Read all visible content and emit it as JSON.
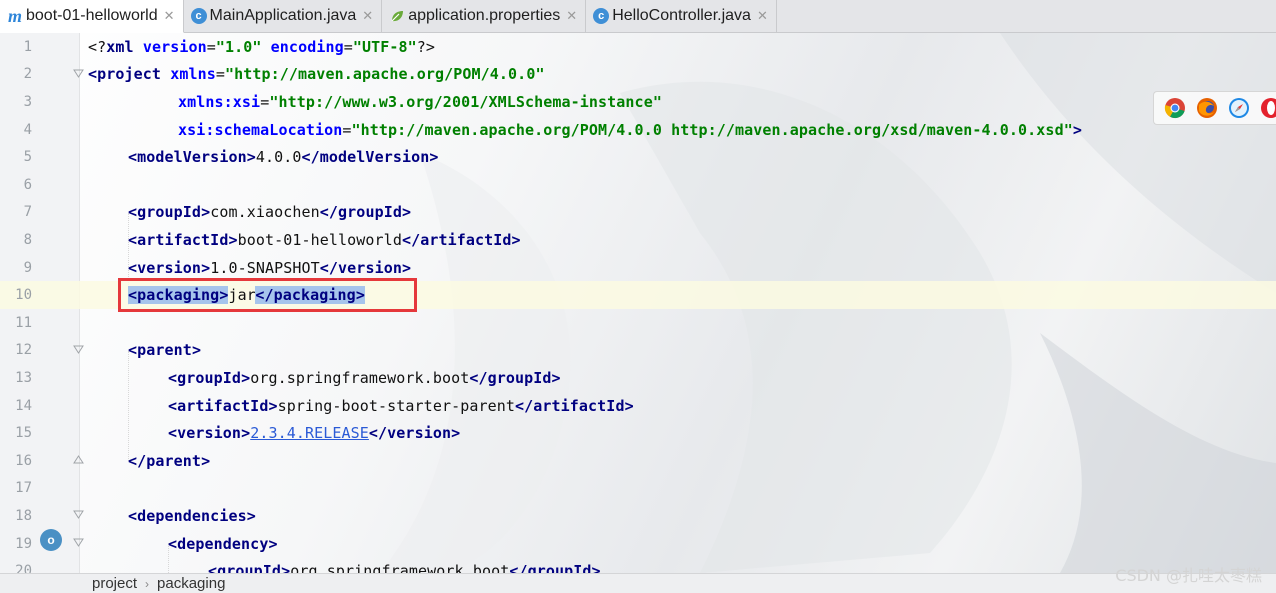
{
  "tabs": [
    {
      "label": "boot-01-helloworld",
      "icon": "maven-m-icon",
      "active": true
    },
    {
      "label": "MainApplication.java",
      "icon": "java-class-icon",
      "active": false
    },
    {
      "label": "application.properties",
      "icon": "spring-leaf-icon",
      "active": false
    },
    {
      "label": "HelloController.java",
      "icon": "java-class-icon",
      "active": false
    }
  ],
  "tab_close_glyph": "✕",
  "line_numbers": [
    "1",
    "2",
    "3",
    "4",
    "5",
    "6",
    "7",
    "8",
    "9",
    "10",
    "11",
    "12",
    "13",
    "14",
    "15",
    "16",
    "17",
    "18",
    "19",
    "20"
  ],
  "code": {
    "l1_decl_open": "<?",
    "l1_xml": "xml",
    "l1_version_attr": "version",
    "l1_version_val": "\"1.0\"",
    "l1_encoding_attr": "encoding",
    "l1_encoding_val": "\"UTF-8\"",
    "l1_decl_close": "?>",
    "l2_open": "<",
    "l2_project": "project",
    "l2_xmlns_attr": "xmlns",
    "l2_xmlns_val": "\"http://maven.apache.org/POM/4.0.0\"",
    "l3_xsi_attr": "xmlns:xsi",
    "l3_xsi_val": "\"http://www.w3.org/2001/XMLSchema-instance\"",
    "l4_schema_attr": "xsi:schemaLocation",
    "l4_schema_val": "\"http://maven.apache.org/POM/4.0.0 http://maven.apache.org/xsd/maven-4.0.0.xsd\"",
    "l4_close": ">",
    "modelVersion_tag": "modelVersion",
    "modelVersion_val": "4.0.0",
    "groupId_tag": "groupId",
    "groupId_val": "com.xiaochen",
    "artifactId_tag": "artifactId",
    "artifactId_val": "boot-01-helloworld",
    "version_tag": "version",
    "version_val": "1.0-SNAPSHOT",
    "packaging_tag": "packaging",
    "packaging_val_a": "jar",
    "parent_tag": "parent",
    "parent_groupId_val": "org.springframework.boot",
    "parent_artifactId_val": "spring-boot-starter-parent",
    "parent_version_val": "2.3.4.RELEASE",
    "dependencies_tag": "dependencies",
    "dependency_tag": "dependency",
    "dep_groupId_val": "org.springframework.boot"
  },
  "breadcrumb": [
    "project",
    "packaging"
  ],
  "breadcrumb_sep": "›",
  "watermark": "CSDN @扎哇太枣糕",
  "colors": {
    "tag": "#000080",
    "attr": "#0000ff",
    "string": "#008000",
    "selection": "#a6c4ec",
    "highlight_box": "#e5383b",
    "current_line": "#fcfae2"
  },
  "browser_icons": [
    "chrome-icon",
    "firefox-icon",
    "safari-icon",
    "opera-icon"
  ]
}
